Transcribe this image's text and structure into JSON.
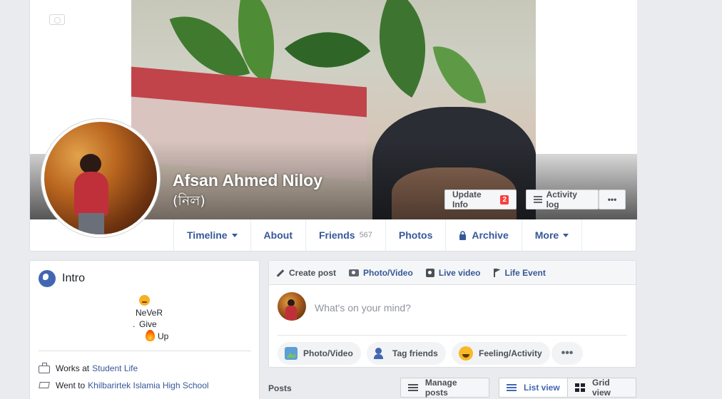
{
  "profile": {
    "name": "Afsan Ahmed Niloy",
    "alt_name": "(নিল)"
  },
  "cover_actions": {
    "update_info": "Update Info",
    "update_badge": "2",
    "activity_log": "Activity log",
    "more": "•••"
  },
  "nav": {
    "tabs": [
      {
        "label": "Timeline"
      },
      {
        "label": "About"
      },
      {
        "label": "Friends",
        "count": "567"
      },
      {
        "label": "Photos"
      },
      {
        "label": "Archive"
      },
      {
        "label": "More"
      }
    ]
  },
  "intro": {
    "title": "Intro",
    "bio_line_1": "NeVeR",
    "bio_dot": ".",
    "bio_line_2": "Give",
    "bio_line_3": "Up",
    "works_prefix": "Works at",
    "works_place": "Student Life",
    "went_prefix": "Went to",
    "went_place": "Khilbarirtek Islamia High School"
  },
  "composer": {
    "tabs": [
      {
        "label": "Create post"
      },
      {
        "label": "Photo/Video"
      },
      {
        "label": "Live video"
      },
      {
        "label": "Life Event"
      }
    ],
    "placeholder": "What's on your mind?",
    "pills": {
      "photo": "Photo/Video",
      "tag": "Tag friends",
      "feeling": "Feeling/Activity",
      "more": "•••"
    }
  },
  "posts_bar": {
    "label": "Posts",
    "manage": "Manage posts",
    "list_view": "List view",
    "grid_view": "Grid view"
  },
  "colors": {
    "link": "#365899",
    "brand": "#4267b2",
    "background": "#e9ebee",
    "badge": "#fa3e3e"
  }
}
